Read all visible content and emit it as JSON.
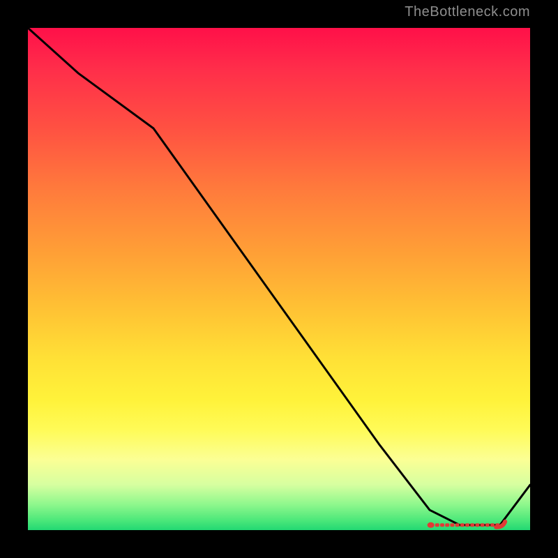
{
  "watermark": "TheBottleneck.com",
  "chart_data": {
    "type": "line",
    "title": "",
    "xlabel": "",
    "ylabel": "",
    "xlim": [
      0,
      100
    ],
    "ylim": [
      0,
      100
    ],
    "grid": false,
    "legend": false,
    "series": [
      {
        "name": "main-curve",
        "color": "#000000",
        "x": [
          0,
          10,
          25,
          40,
          55,
          70,
          80,
          86,
          90,
          94,
          100
        ],
        "y": [
          100,
          91,
          80,
          59,
          38,
          17,
          4,
          1,
          1,
          1,
          9
        ]
      },
      {
        "name": "optimal-band",
        "type": "scatter",
        "color": "#e03a36",
        "style": "dashed-dots",
        "x": [
          80.5,
          81.5,
          82.5,
          83.5,
          84.5,
          85.5,
          86.5,
          87.5,
          88.5,
          89.5,
          90.5,
          91.5,
          92.5,
          93.5
        ],
        "y": [
          1,
          1,
          1,
          1,
          1,
          1,
          1,
          1,
          1,
          1,
          1,
          1,
          1,
          1
        ]
      }
    ],
    "annotations": []
  }
}
